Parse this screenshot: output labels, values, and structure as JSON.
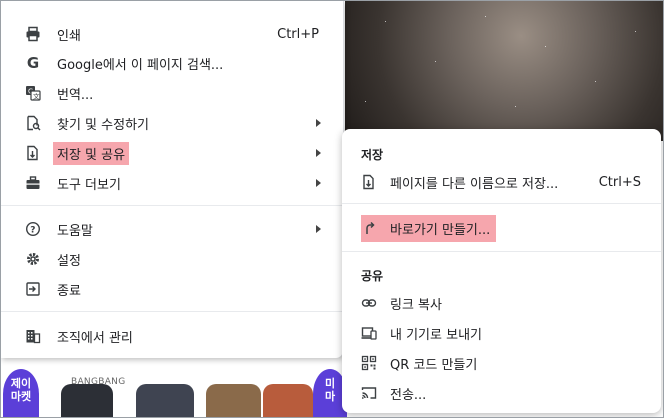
{
  "background": {
    "left_badge": "제이\n마켓",
    "right_badge": "미\n마",
    "brand": "BANGBANG"
  },
  "menu": {
    "items": [
      {
        "label": "인쇄",
        "icon": "printer-icon",
        "shortcut": "Ctrl+P"
      },
      {
        "label": "Google에서 이 페이지 검색...",
        "icon": "google-icon"
      },
      {
        "label": "번역...",
        "icon": "translate-icon"
      },
      {
        "label": "찾기 및 수정하기",
        "icon": "find-icon",
        "submenu": true
      },
      {
        "label": "저장 및 공유",
        "icon": "save-share-icon",
        "submenu": true,
        "highlighted": true
      },
      {
        "label": "도구 더보기",
        "icon": "toolbox-icon",
        "submenu": true
      },
      {
        "label": "도움말",
        "icon": "help-icon",
        "submenu": true
      },
      {
        "label": "설정",
        "icon": "settings-icon"
      },
      {
        "label": "종료",
        "icon": "exit-icon"
      },
      {
        "label": "조직에서 관리",
        "icon": "organization-icon"
      }
    ]
  },
  "submenu": {
    "save_heading": "저장",
    "save_page_label": "페이지를 다른 이름으로 저장...",
    "save_page_shortcut": "Ctrl+S",
    "shortcut_label": "바로가기 만들기...",
    "share_heading": "공유",
    "copy_link_label": "링크 복사",
    "send_devices_label": "내 기기로 보내기",
    "qr_label": "QR 코드 만들기",
    "cast_label": "전송..."
  },
  "colors": {
    "highlight": "#f6a6ad",
    "text": "#202124",
    "divider": "#e8eaed"
  }
}
